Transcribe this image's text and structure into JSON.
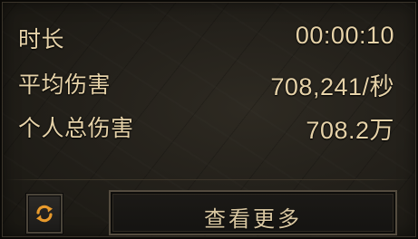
{
  "stats": {
    "duration": {
      "label": "时长",
      "value": "00:00:10"
    },
    "avg_damage": {
      "label": "平均伤害",
      "value": "708,241/秒"
    },
    "total_damage": {
      "label": "个人总伤害",
      "value": "708.2万"
    }
  },
  "actions": {
    "refresh_icon": "refresh-arrows-icon",
    "view_more_label": "查看更多"
  },
  "colors": {
    "text": "#e6d2a8",
    "icon_orange": "#e89a2c",
    "panel_bg": "#24211b",
    "button_border": "#544c3f"
  }
}
